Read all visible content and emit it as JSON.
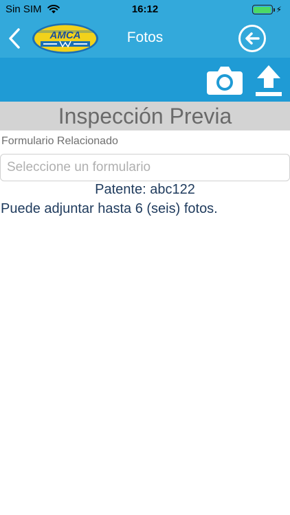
{
  "status_bar": {
    "carrier": "Sin SIM",
    "time": "16:12"
  },
  "nav": {
    "title": "Fotos",
    "logo_text": "AMCA",
    "icons": {
      "back": "chevron-left-icon",
      "action": "circle-arrow-left-icon"
    }
  },
  "toolbar": {
    "icons": {
      "camera": "camera-icon",
      "upload": "upload-icon"
    }
  },
  "section": {
    "title": "Inspección Previa"
  },
  "form": {
    "label": "Formulario Relacionado",
    "select_placeholder": "Seleccione un formulario"
  },
  "info": {
    "plate": "Patente: abc122",
    "note": "Puede adjuntar hasta 6 (seis) fotos."
  },
  "colors": {
    "nav_blue": "#33a9db",
    "toolbar_blue": "#1f9bd5",
    "header_gray": "#d3d3d3",
    "text_navy": "#1e3a5c",
    "logo_yellow": "#f2d21b"
  }
}
